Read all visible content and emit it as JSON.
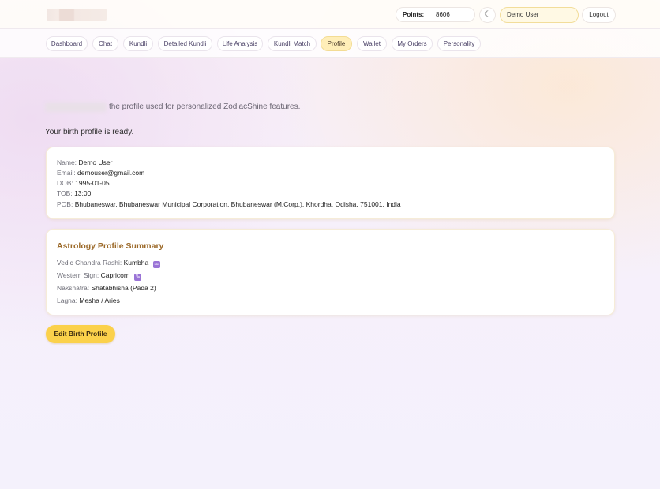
{
  "header": {
    "points_label": "Points:",
    "points_value": "8606",
    "theme_icon": "moon-icon",
    "user_name": "Demo User",
    "logout_label": "Logout"
  },
  "nav": {
    "tabs": [
      {
        "label": "Dashboard"
      },
      {
        "label": "Chat"
      },
      {
        "label": "Kundli"
      },
      {
        "label": "Detailed Kundli"
      },
      {
        "label": "Life Analysis"
      },
      {
        "label": "Kundli Match"
      },
      {
        "label": "Profile",
        "active": true
      },
      {
        "label": "Wallet"
      },
      {
        "label": "My Orders"
      },
      {
        "label": "Personality"
      }
    ]
  },
  "page": {
    "subtitle": "the profile used for personalized ZodiacShine features.",
    "status": "Your birth profile is ready."
  },
  "profile": {
    "name_label": "Name:",
    "name": "Demo User",
    "email_label": "Email:",
    "email": "demouser@gmail.com",
    "dob_label": "DOB:",
    "dob": "1995-01-05",
    "tob_label": "TOB:",
    "tob": "13:00",
    "pob_label": "POB:",
    "pob": "Bhubaneswar, Bhubaneswar Municipal Corporation, Bhubaneswar (M.Corp.), Khordha, Odisha, 751001, India"
  },
  "summary": {
    "title": "Astrology Profile Summary",
    "rashi_label": "Vedic Chandra Rashi:",
    "rashi": "Kumbha",
    "rashi_symbol": "♒",
    "western_label": "Western Sign:",
    "western": "Capricorn",
    "western_symbol": "♑",
    "nakshatra_label": "Nakshatra:",
    "nakshatra": "Shatabhisha (Pada 2)",
    "lagna_label": "Lagna:",
    "lagna": "Mesha / Aries"
  },
  "actions": {
    "edit_label": "Edit Birth Profile"
  },
  "colors": {
    "accent": "#fbd14b",
    "active_tab": "#ffeeb8",
    "summary_title": "#9c6a2a",
    "zodiac_icon": "#9a74d6"
  }
}
